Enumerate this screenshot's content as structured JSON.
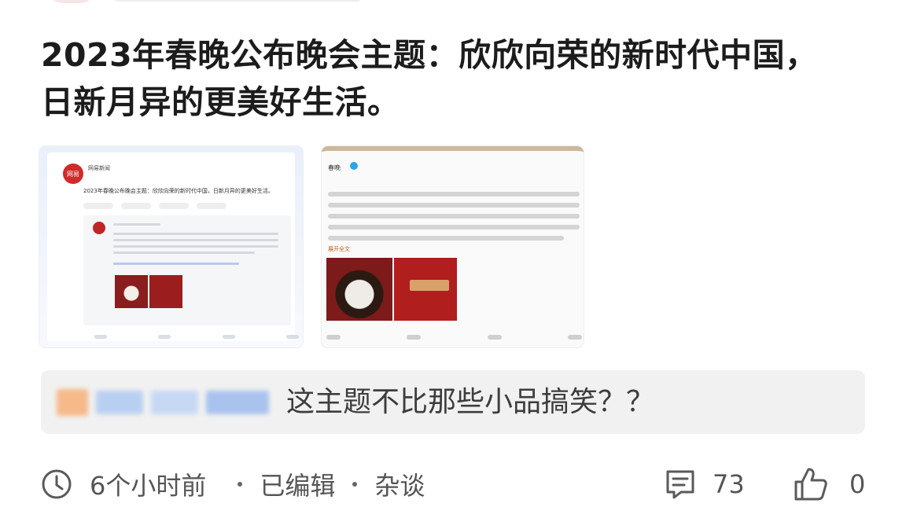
{
  "post": {
    "title": "2023年春晚公布晚会主题：欣欣向荣的新时代中国，日新月异的更美好生活。"
  },
  "images": [
    {
      "name": "weibo-screenshot-netease",
      "source_label": "网易新闻",
      "text": "2023年春晚公布晚会主题：欣欣向荣的新时代中国，日新月异的更美好生活。",
      "avatar_label": "网易"
    },
    {
      "name": "weibo-screenshot-chunwan",
      "account": "春晚",
      "more_label": "展开全文"
    }
  ],
  "quoted_comment": {
    "text": "这主题不比那些小品搞笑？？"
  },
  "meta": {
    "time": "6个小时前",
    "edited": "已编辑",
    "category": "杂谈",
    "comment_count": "73",
    "like_count": "0"
  },
  "icons": {
    "time": "clock-icon",
    "comments": "comment-icon",
    "likes": "thumbs-up-icon"
  },
  "colors": {
    "title_text": "#1c1c1c",
    "meta_text": "#555555",
    "comment_bg": "#f1f1f1",
    "netease_red": "#d02a2a"
  }
}
